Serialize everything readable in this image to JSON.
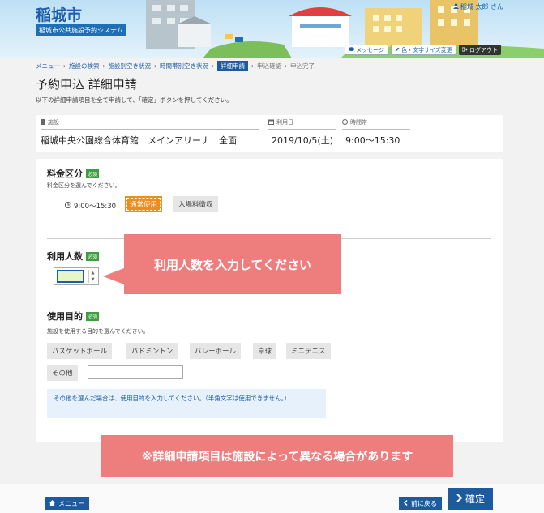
{
  "header": {
    "title": "稲城市",
    "subtitle": "稲城市公共施設予約システム",
    "user": "稲城 太郎 さん",
    "message_label": "メッセージ",
    "text_size_label": "色・文字サイズ変更",
    "logout_label": "ログアウト"
  },
  "breadcrumb": {
    "items": [
      "メニュー",
      "施設の検索",
      "施設別空き状況",
      "時間帯別空き状況"
    ],
    "current": "詳細申請",
    "upcoming": [
      "申込確認",
      "申込完了"
    ],
    "separator": "›"
  },
  "page": {
    "title": "予約申込 詳細申請",
    "description": "以下の詳細申請項目を全て申請して、「確定」ボタンを押してください。"
  },
  "facility": {
    "facility_header": "施設",
    "facility_value": "稲城中央公園総合体育館　メインアリーナ　全面",
    "date_header": "利用日",
    "date_value": "2019/10/5(土)",
    "time_header": "時間帯",
    "time_value": "9:00〜15:30"
  },
  "fee": {
    "title": "料金区分",
    "required": "必須",
    "description": "料金区分を選んでください。",
    "time": "9:00〜15:30",
    "options": [
      "通常使用",
      "入場料徴収"
    ]
  },
  "people": {
    "title": "利用人数",
    "required": "必須"
  },
  "purpose": {
    "title": "使用目的",
    "required": "必須",
    "description": "施設を使用する目的を選んでください。",
    "options": [
      "バスケットボール",
      "バドミントン",
      "バレーボール",
      "卓球",
      "ミニテニス"
    ],
    "other_label": "その他",
    "note": "その他を選んだ場合は、使用目的を入力してください。（半角文字は使用できません。）"
  },
  "callouts": {
    "people": "利用人数を入力してください",
    "note": "※詳細申請項目は施設によって異なる場合があります"
  },
  "footer": {
    "menu_label": "メニュー",
    "back_label": "前に戻る",
    "confirm_label": "確定"
  },
  "colors": {
    "accent": "#1d5a9e",
    "selected": "#f08c1e",
    "callout": "#ee7d7d",
    "required": "#3f9d3f"
  }
}
